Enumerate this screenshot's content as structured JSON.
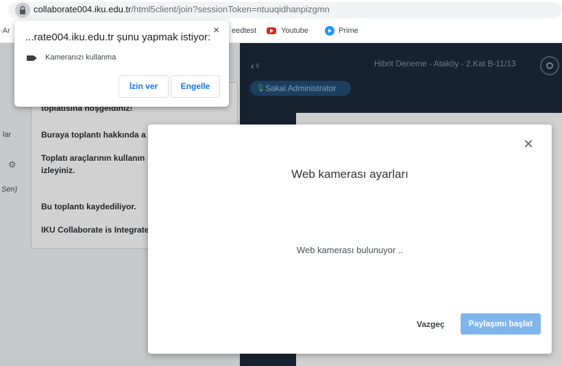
{
  "browser": {
    "url_host": "collaborate004.iku.edu.tr",
    "url_path": "/html5client/join?sessionToken=ntuuqidhanpizgmn"
  },
  "bookmarks": {
    "items": [
      {
        "label": "·Ar"
      },
      {
        "label": "eedtest"
      },
      {
        "label": "Youtube"
      },
      {
        "label": "Prime"
      }
    ]
  },
  "permission_popup": {
    "title": "...rate004.iku.edu.tr şunu yapmak istiyor:",
    "close_icon": "×",
    "request_text": "Kameranızı kullanma",
    "allow_label": "İzin ver",
    "block_label": "Engelle"
  },
  "sidebar": {
    "labels": [
      "lar",
      "⚙",
      "Sen)"
    ]
  },
  "chat": {
    "lines": [
      "toplatısına hoşgeldiniz!",
      "Buraya toplantı hakkında a",
      "Toplatı araçlarının kullanın",
      "izleyiniz.",
      "Bu toplantı kaydediliyor.",
      "IKU Collaborate is Integrate"
    ]
  },
  "meeting": {
    "header_icon": "‹♀",
    "title": "Hibrit Deneme - Ataköy - 2.Kat B-11/13",
    "presenter": "Sakai Administrator",
    "mic_icon": "🎙"
  },
  "modal": {
    "close_icon": "×",
    "title": "Web kamerası ayarları",
    "status": "Web kamerası bulunuyor ..",
    "cancel_label": "Vazgeç",
    "share_label": "Paylaşımı başlat"
  }
}
